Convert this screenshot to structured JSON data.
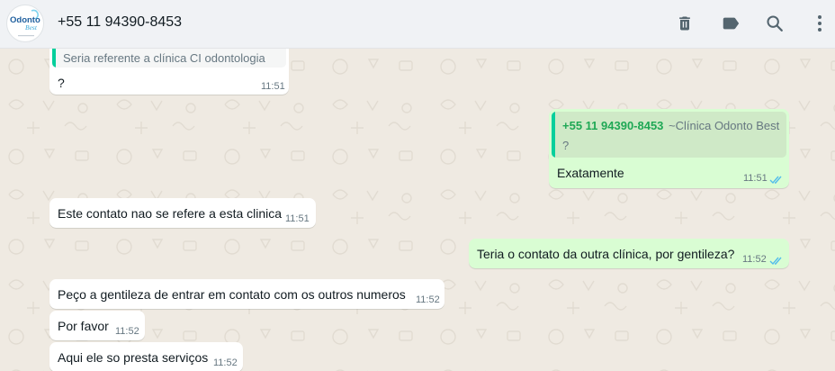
{
  "header": {
    "contact_name": "+55 11 94390-8453",
    "avatar_logo_line1": "Odonto",
    "avatar_logo_line2": "Best",
    "icons": [
      "avatar-logo",
      "delete-icon",
      "label-icon",
      "search-icon",
      "menu-icon"
    ]
  },
  "colors": {
    "header_bg": "#f0f2f5",
    "chat_bg": "#efeae2",
    "incoming_bubble": "#ffffff",
    "outgoing_bubble": "#d9fdd3",
    "quote_accent": "#06cf9c",
    "read_ticks": "#53bdeb"
  },
  "messages": [
    {
      "direction": "in",
      "quoted_text": "Seria referente a clínica CI odontologia",
      "text": "?",
      "time": "11:51"
    },
    {
      "direction": "out",
      "quoted_author": "+55 11 94390-8453",
      "quoted_pushname": "~Clínica Odonto Best",
      "quoted_text": "?",
      "text": "Exatamente",
      "time": "11:51",
      "status": "read"
    },
    {
      "direction": "in",
      "text": "Este contato nao se refere a esta clinica",
      "time": "11:51"
    },
    {
      "direction": "out",
      "text": "Teria o contato da outra clínica, por gentileza?",
      "time": "11:52",
      "status": "read"
    },
    {
      "direction": "in",
      "text": "Peço a gentileza de entrar em contato com os outros numeros",
      "time": "11:52"
    },
    {
      "direction": "in",
      "text": "Por favor",
      "time": "11:52"
    },
    {
      "direction": "in",
      "text": "Aqui ele so presta serviços",
      "time": "11:52"
    }
  ]
}
